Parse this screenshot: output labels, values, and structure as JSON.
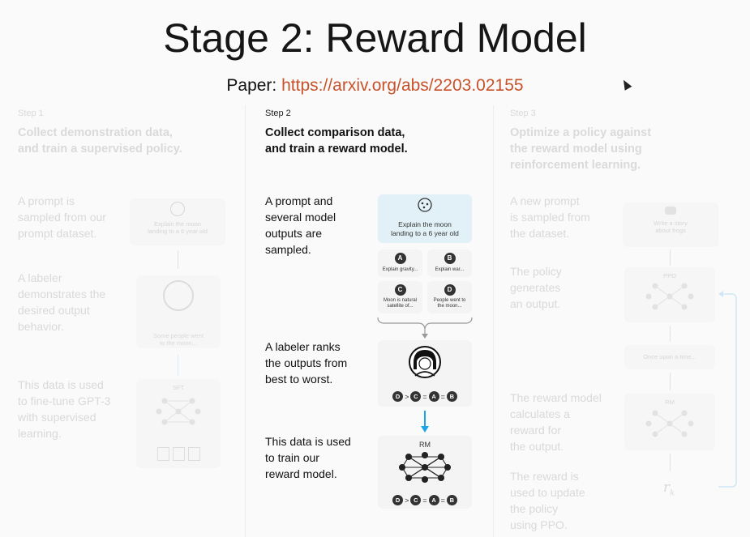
{
  "title": "Stage 2: Reward Model",
  "paper": {
    "label": "Paper:",
    "url": "https://arxiv.org/abs/2203.02155"
  },
  "col1": {
    "step": "Step 1",
    "heading_l1": "Collect demonstration data,",
    "heading_l2": "and train a supervised policy.",
    "blocks": [
      [
        "A prompt is",
        "sampled from our",
        "prompt dataset."
      ],
      [
        "A labeler",
        "demonstrates the",
        "desired output",
        "behavior."
      ],
      [
        "This data is used",
        "to fine-tune GPT-3",
        "with supervised",
        "learning."
      ]
    ],
    "prompt_card": [
      "Explain the moon",
      "landing to a 6 year old"
    ],
    "labeler_card": [
      "Some people went",
      "to the moon..."
    ],
    "model_label": "SFT"
  },
  "col2": {
    "step": "Step 2",
    "heading_l1": "Collect comparison data,",
    "heading_l2": "and train a reward model.",
    "blocks": [
      [
        "A prompt and",
        "several model",
        "outputs are",
        "sampled."
      ],
      [
        "A labeler ranks",
        "the outputs from",
        "best to worst."
      ],
      [
        "This data is used",
        "to train our",
        "reward model."
      ]
    ],
    "prompt_card": [
      "Explain the moon",
      "landing to a 6 year old"
    ],
    "outputs": [
      {
        "letter": "A",
        "text": [
          "Explain gravity..."
        ]
      },
      {
        "letter": "B",
        "text": [
          "Explain war..."
        ]
      },
      {
        "letter": "C",
        "text": [
          "Moon is natural",
          "satellite of..."
        ]
      },
      {
        "letter": "D",
        "text": [
          "People went to",
          "the moon..."
        ]
      }
    ],
    "ranking": [
      "D",
      "C",
      "A",
      "B"
    ],
    "model_label": "RM"
  },
  "col3": {
    "step": "Step 3",
    "heading_l1": "Optimize a policy against",
    "heading_l2": "the reward model using",
    "heading_l3": "reinforcement learning.",
    "blocks": [
      [
        "A new prompt",
        "is sampled from",
        "the dataset."
      ],
      [
        "The policy",
        "generates",
        "an output."
      ],
      [
        "The reward model",
        "calculates a",
        "reward for",
        "the output."
      ],
      [
        "The reward is",
        "used to update",
        "the policy",
        "using PPO."
      ]
    ],
    "prompt_card": [
      "Write a story",
      "about frogs"
    ],
    "ppo_label": "PPO",
    "output_card": "Once upon a time...",
    "rm_label": "RM",
    "reward_symbol": "r",
    "reward_sub": "k"
  },
  "colors": {
    "link": "#c8522a",
    "arrow_blue": "#1aa5e8",
    "faded": "#d9d9d9"
  }
}
